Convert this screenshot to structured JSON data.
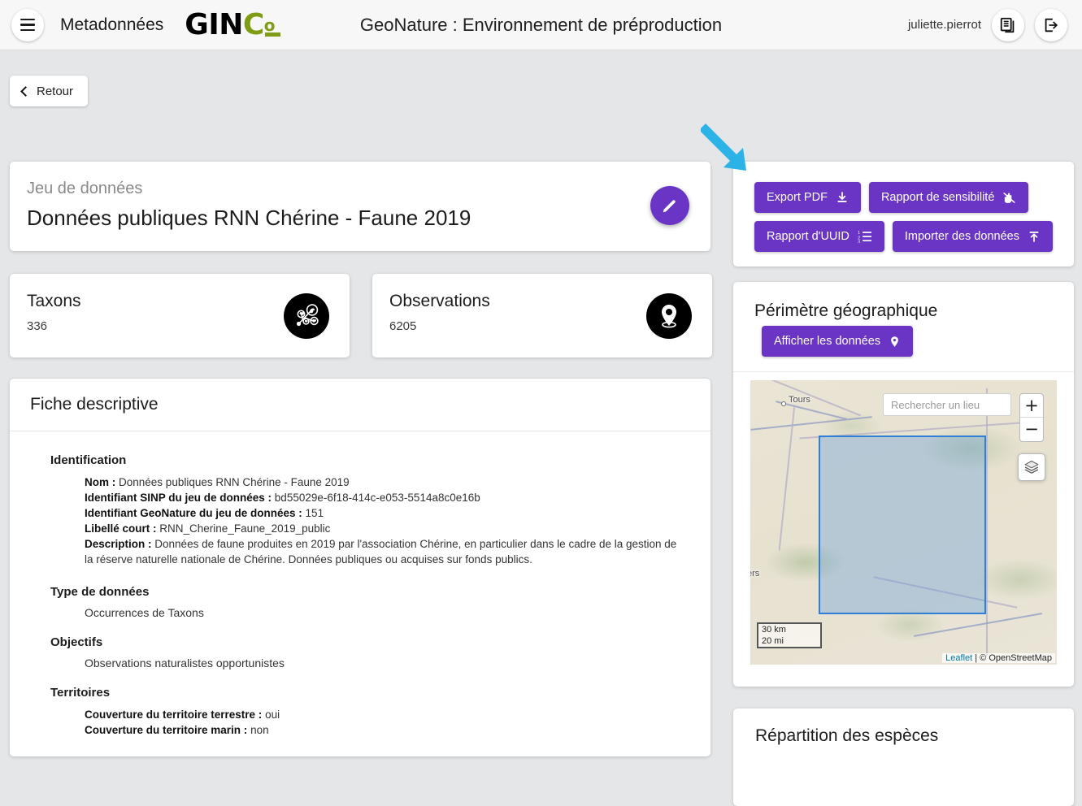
{
  "header": {
    "menu_icon": "hamburger-icon",
    "module_name": "Metadonnées",
    "logo": {
      "part1": "GIN",
      "part2": "C",
      "part3": "o"
    },
    "app_title": "GeoNature : Environnement de préproduction",
    "username": "juliette.pierrot",
    "docs_icon": "documents-icon",
    "logout_icon": "logout-icon"
  },
  "nav": {
    "back_label": "Retour",
    "back_icon": "chevron-left-icon"
  },
  "dataset": {
    "kicker": "Jeu de données",
    "title": "Données publiques RNN Chérine - Faune 2019",
    "edit_icon": "pencil-icon"
  },
  "stats": [
    {
      "label": "Taxons",
      "value": "336",
      "icon": "taxonomy-icon"
    },
    {
      "label": "Observations",
      "value": "6205",
      "icon": "map-pin-icon"
    }
  ],
  "actions": {
    "export_pdf": "Export PDF",
    "export_pdf_icon": "download-icon",
    "rapport_sensibilite": "Rapport de sensibilité",
    "rapport_sensibilite_icon": "hand-block-icon",
    "rapport_uuid": "Rapport d'UUID",
    "rapport_uuid_icon": "ordered-list-icon",
    "importer": "Importer des données",
    "importer_icon": "upload-icon"
  },
  "fiche": {
    "header": "Fiche descriptive",
    "identification": {
      "heading": "Identification",
      "rows": [
        {
          "label": "Nom :",
          "value": "Données publiques RNN Chérine - Faune 2019"
        },
        {
          "label": "Identifiant SINP du jeu de données :",
          "value": "bd55029e-6f18-414c-e053-5514a8c0e16b"
        },
        {
          "label": "Identifiant GeoNature du jeu de données :",
          "value": "151"
        },
        {
          "label": "Libellé court :",
          "value": "RNN_Cherine_Faune_2019_public"
        },
        {
          "label": "Description :",
          "value": "Données de faune produites en 2019 par l'association Chérine, en particulier dans le cadre de la gestion de la réserve naturelle nationale de Chérine. Données publiques ou acquises sur fonds publics."
        }
      ]
    },
    "type_donnees": {
      "heading": "Type de données",
      "value": "Occurrences de Taxons"
    },
    "objectifs": {
      "heading": "Objectifs",
      "value": "Observations naturalistes opportunistes"
    },
    "territoires": {
      "heading": "Territoires",
      "rows": [
        {
          "label": "Couverture du territoire terrestre :",
          "value": "oui"
        },
        {
          "label": "Couverture du territoire marin :",
          "value": "non"
        }
      ]
    }
  },
  "perimetre": {
    "title": "Périmètre géographique",
    "show_data_label": "Afficher les données",
    "show_data_icon": "map-pin-icon",
    "map": {
      "search_placeholder": "Rechercher un lieu",
      "zoom_in": "+",
      "zoom_out": "−",
      "layers_icon": "layers-icon",
      "town_label": "Tours",
      "town_label_partial": "ers",
      "scale_km": "30 km",
      "scale_mi": "20 mi",
      "attrib_leaflet": "Leaflet",
      "attrib_rest": "| © OpenStreetMap"
    }
  },
  "repartition": {
    "title": "Répartition des espèces"
  },
  "annotation": {
    "arrow": "annotation-arrow",
    "color": "#2bb3e8"
  },
  "colors": {
    "primary": "#6a34c4",
    "logo_green": "#7f9c15",
    "page_bg": "#e4e6e8",
    "header_bg": "#f7f7f7",
    "bbox_blue": "#2f7fd6"
  }
}
